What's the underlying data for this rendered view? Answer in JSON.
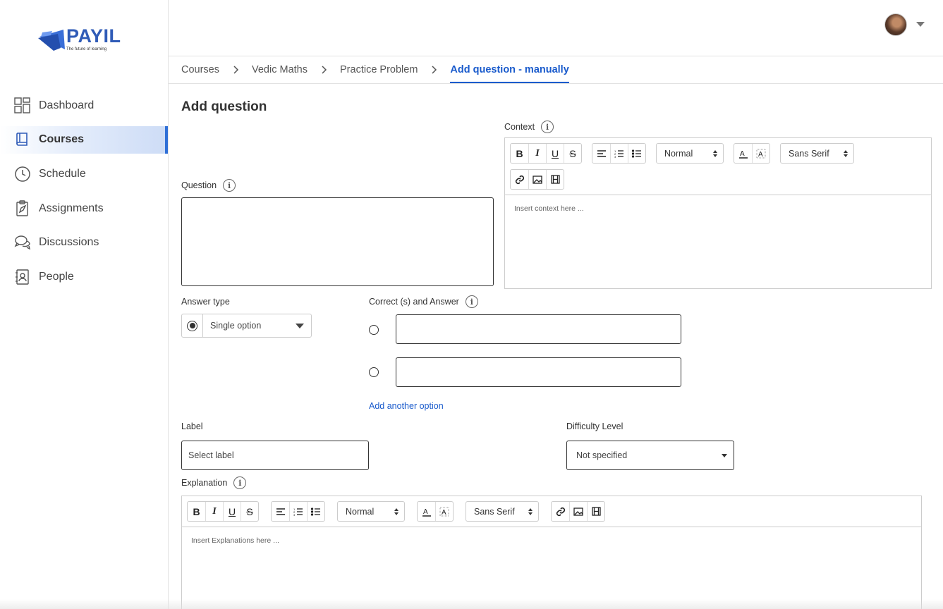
{
  "brand": {
    "name": "PAYIL",
    "tagline": "The future of learning",
    "accent": "#2f5bb7"
  },
  "sidebar": {
    "items": [
      {
        "label": "Dashboard",
        "icon": "dashboard-icon",
        "active": false
      },
      {
        "label": "Courses",
        "icon": "book-icon",
        "active": true
      },
      {
        "label": "Schedule",
        "icon": "clock-icon",
        "active": false
      },
      {
        "label": "Assignments",
        "icon": "clipboard-icon",
        "active": false
      },
      {
        "label": "Discussions",
        "icon": "chat-bubbles-icon",
        "active": false
      },
      {
        "label": "People",
        "icon": "contact-book-icon",
        "active": false
      }
    ]
  },
  "header": {
    "avatar": "user-avatar",
    "menu_icon": "caret-down-icon"
  },
  "breadcrumb": [
    {
      "label": "Courses"
    },
    {
      "label": "Vedic Maths"
    },
    {
      "label": "Practice Problem"
    },
    {
      "label": "Add question - manually",
      "current": true
    }
  ],
  "page": {
    "title": "Add question"
  },
  "form": {
    "context": {
      "label": "Context",
      "placeholder": "Insert context here ...",
      "toolbar": {
        "header": "Normal",
        "font": "Sans Serif"
      }
    },
    "question": {
      "label": "Question",
      "value": ""
    },
    "answer_type": {
      "label": "Answer type",
      "value": "Single option"
    },
    "answers": {
      "label": "Correct (s) and Answer",
      "options": [
        {
          "value": ""
        },
        {
          "value": ""
        }
      ],
      "add_label": "Add another option"
    },
    "label_field": {
      "label": "Label",
      "placeholder": "Select label"
    },
    "difficulty": {
      "label": "Difficulty Level",
      "value": "Not specified"
    },
    "explanation": {
      "label": "Explanation",
      "placeholder": "Insert Explanations here ...",
      "toolbar": {
        "header": "Normal",
        "font": "Sans Serif"
      }
    }
  }
}
